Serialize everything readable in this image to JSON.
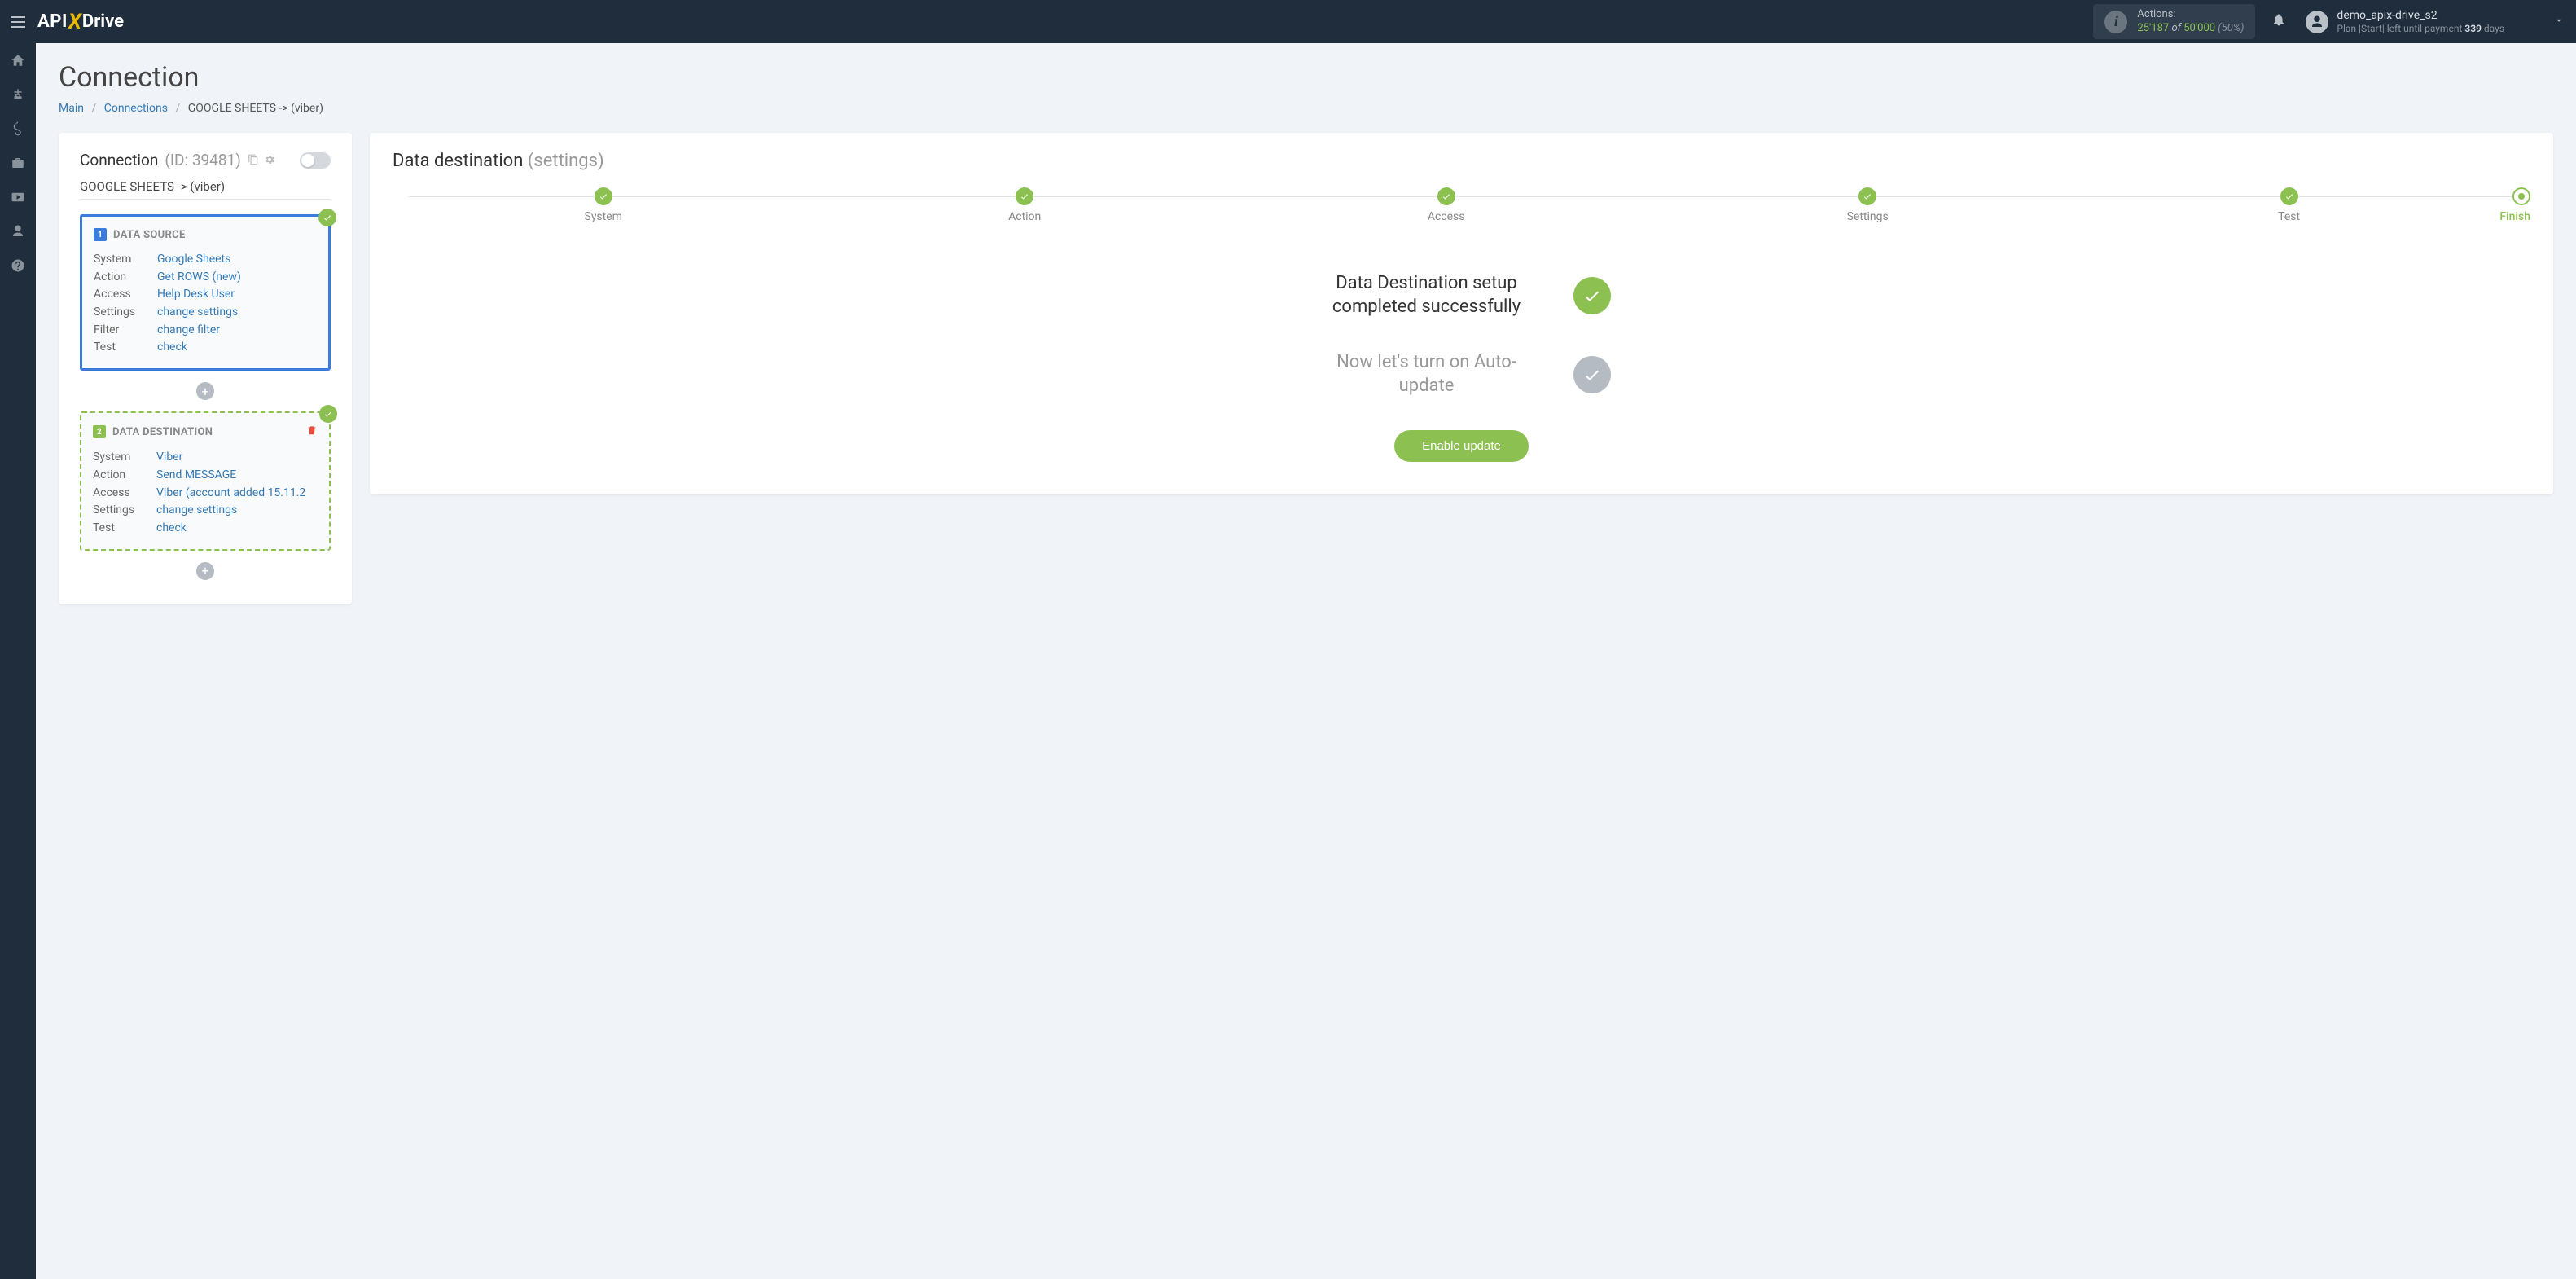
{
  "topbar": {
    "actions_label": "Actions:",
    "actions_used": "25'187",
    "actions_of": "of",
    "actions_total": "50'000",
    "actions_pct": "(50%)",
    "user_name": "demo_apix-drive_s2",
    "plan_prefix": "Plan |Start| left until payment ",
    "plan_days": "339",
    "plan_suffix": " days"
  },
  "page": {
    "title": "Connection",
    "crumb_main": "Main",
    "crumb_connections": "Connections",
    "crumb_current": "GOOGLE SHEETS -> (viber)"
  },
  "conn_panel": {
    "head": "Connection",
    "id": "(ID: 39481)",
    "name": "GOOGLE SHEETS -> (viber)",
    "src_title": "DATA SOURCE",
    "dst_title": "DATA DESTINATION",
    "labels": {
      "system": "System",
      "action": "Action",
      "access": "Access",
      "settings": "Settings",
      "filter": "Filter",
      "test": "Test"
    },
    "src": {
      "system": "Google Sheets",
      "action": "Get ROWS (new)",
      "access": "Help Desk User",
      "settings": "change settings",
      "filter": "change filter",
      "test": "check"
    },
    "dst": {
      "system": "Viber",
      "action": "Send MESSAGE",
      "access": "Viber (account added 15.11.2",
      "settings": "change settings",
      "test": "check"
    }
  },
  "right": {
    "title": "Data destination",
    "title_sub": "(settings)",
    "steps": [
      "System",
      "Action",
      "Access",
      "Settings",
      "Test",
      "Finish"
    ],
    "status1": "Data Destination setup completed successfully",
    "status2": "Now let's turn on Auto-update",
    "button": "Enable update"
  }
}
